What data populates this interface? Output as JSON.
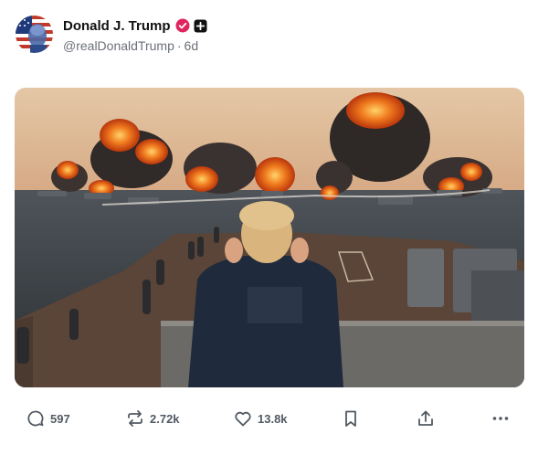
{
  "author": {
    "display_name": "Donald J. Trump",
    "handle": "@realDonaldTrump",
    "separator": "·",
    "age": "6d"
  },
  "badges": {
    "verified_icon": "verified-check-icon",
    "follow_icon": "follow-plus-icon",
    "verified_color": "#e0245e"
  },
  "media": {
    "kind": "image",
    "icons": [
      "naval-battle-illustration"
    ]
  },
  "actions": {
    "reply_count": "597",
    "repost_count": "2.72k",
    "like_count": "13.8k"
  },
  "colors": {
    "text": "#111111",
    "muted": "#6b7078",
    "action_text": "#525a63"
  }
}
